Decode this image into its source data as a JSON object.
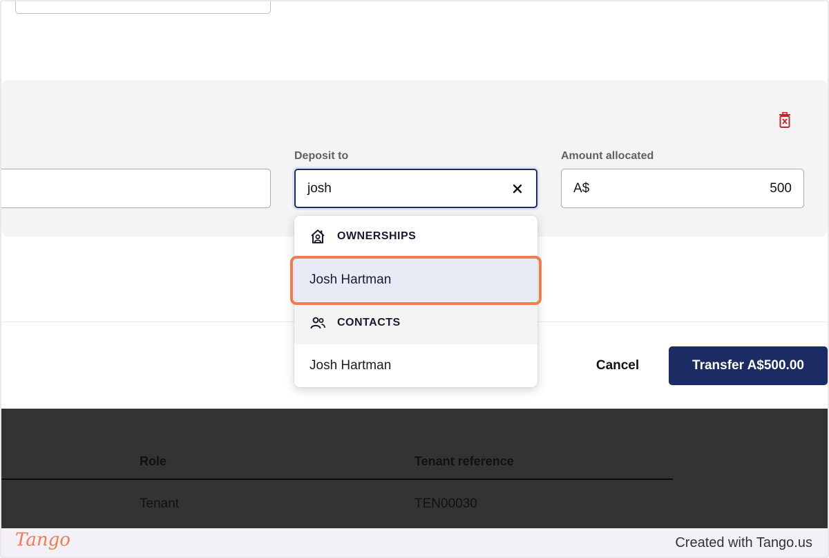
{
  "allocation": {
    "deposit_label": "Deposit to",
    "deposit_value": "josh",
    "amount_label": "Amount allocated",
    "amount_currency": "A$",
    "amount_value": "500"
  },
  "dropdown": {
    "groups": [
      {
        "label": "OWNERSHIPS",
        "icon": "ownership-house-icon",
        "items": [
          "Josh Hartman"
        ]
      },
      {
        "label": "CONTACTS",
        "icon": "people-icon",
        "items": [
          "Josh Hartman"
        ]
      }
    ]
  },
  "actions": {
    "cancel_label": "Cancel",
    "transfer_label": "Transfer A$500.00"
  },
  "table": {
    "headers": [
      "Role",
      "Tenant reference"
    ],
    "rows": [
      [
        "Tenant",
        "TEN00030"
      ]
    ]
  },
  "footer": {
    "logo_text": "Tango",
    "created_with": "Created with Tango.us"
  },
  "colors": {
    "primary": "#1b2b64",
    "highlight": "#ee7e4d",
    "delete": "#c0262d",
    "selected_row": "#e8eaf6"
  }
}
